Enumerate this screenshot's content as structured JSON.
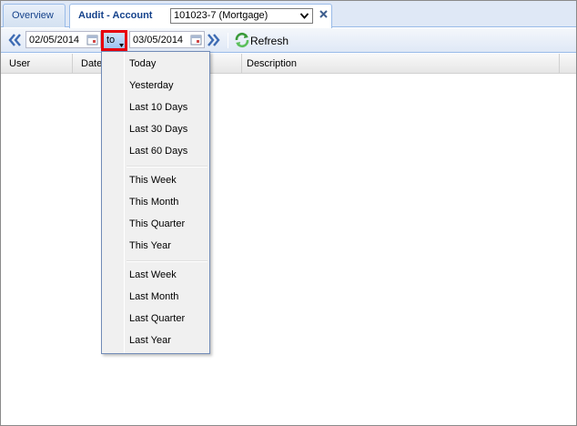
{
  "tabs": {
    "overview_label": "Overview",
    "audit_label": "Audit - Account",
    "account_select_value": "101023-7 (Mortgage)"
  },
  "toolbar": {
    "from_date": "02/05/2014",
    "to_label": "to",
    "to_date": "03/05/2014",
    "refresh_label": "Refresh"
  },
  "grid": {
    "columns": [
      "User",
      "Date",
      "",
      "Description"
    ]
  },
  "menu": {
    "groups": [
      [
        "Today",
        "Yesterday",
        "Last 10 Days",
        "Last 30 Days",
        "Last 60 Days"
      ],
      [
        "This Week",
        "This Month",
        "This Quarter",
        "This Year"
      ],
      [
        "Last Week",
        "Last Month",
        "Last Quarter",
        "Last Year"
      ]
    ]
  },
  "colors": {
    "accent": "#15428b",
    "highlight_border": "#e8000b",
    "toolbar_bg": "#dfe8f6",
    "menu_border": "#718bb7"
  },
  "icons": {
    "prev": "double-chevron-left-icon",
    "next": "double-chevron-right-icon",
    "calendar": "calendar-icon",
    "refresh": "refresh-icon",
    "close": "close-icon",
    "caret": "chevron-down-icon"
  }
}
